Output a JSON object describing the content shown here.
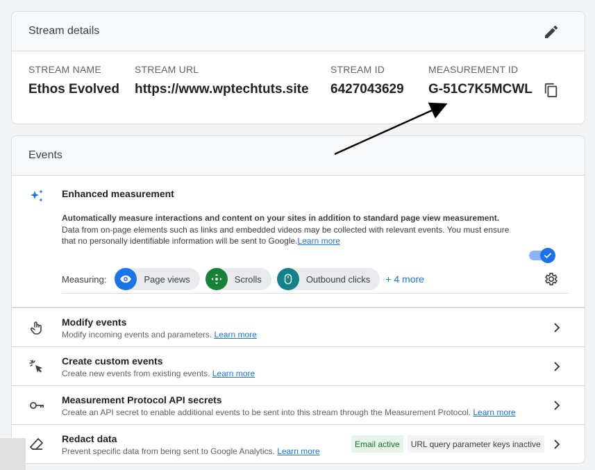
{
  "stream_details": {
    "title": "Stream details",
    "fields": [
      {
        "label": "STREAM NAME",
        "value": "Ethos Evolved"
      },
      {
        "label": "STREAM URL",
        "value": "https://www.wptechtuts.site"
      },
      {
        "label": "STREAM ID",
        "value": "6427043629"
      },
      {
        "label": "MEASUREMENT ID",
        "value": "G-51C7K5MCWL"
      }
    ]
  },
  "events": {
    "title": "Events",
    "enhanced": {
      "title": "Enhanced measurement",
      "desc_bold": "Automatically measure interactions and content on your sites in addition to standard page view measurement.",
      "desc": "Data from on-page elements such as links and embedded videos may be collected with relevant events. You must ensure that no personally identifiable information will be sent to Google.",
      "learn_more": "Learn more",
      "toggle_on": true,
      "measuring_label": "Measuring:",
      "chips": [
        {
          "label": "Page views",
          "icon": "eye-icon",
          "color": "#1a73e8"
        },
        {
          "label": "Scrolls",
          "icon": "scroll-icon",
          "color": "#188038"
        },
        {
          "label": "Outbound clicks",
          "icon": "mouse-icon",
          "color": "#12838b"
        }
      ],
      "more": "+ 4 more"
    },
    "rows": [
      {
        "title": "Modify events",
        "sub": "Modify incoming events and parameters.",
        "link": "Learn more",
        "icon": "touch-icon"
      },
      {
        "title": "Create custom events",
        "sub": "Create new events from existing events.",
        "link": "Learn more",
        "icon": "sparkle-cursor-icon"
      },
      {
        "title": "Measurement Protocol API secrets",
        "sub": "Create an API secret to enable additional events to be sent into this stream through the Measurement Protocol.",
        "link": "Learn more",
        "icon": "key-icon"
      },
      {
        "title": "Redact data",
        "sub": "Prevent specific data from being sent to Google Analytics.",
        "link": "Learn more",
        "icon": "eraser-icon",
        "badges": [
          "Email active",
          "URL query parameter keys inactive"
        ]
      }
    ]
  },
  "colors": {
    "accent": "#1a73e8",
    "annotation_arrow": "#000000"
  }
}
